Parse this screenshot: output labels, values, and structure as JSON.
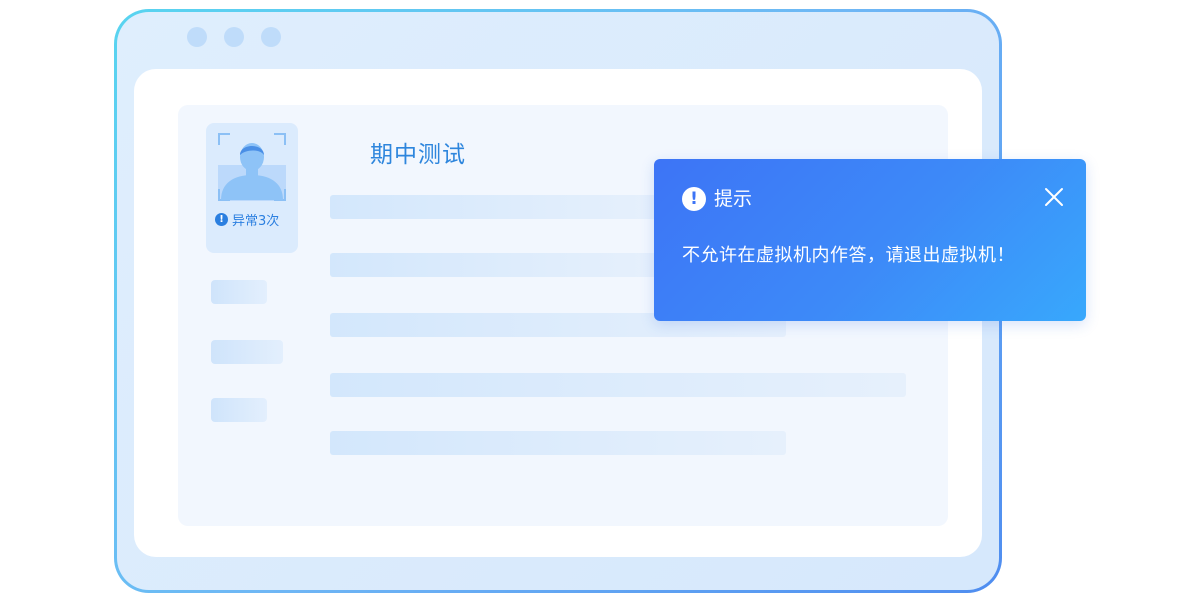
{
  "window": {
    "dots": [
      "dot",
      "dot",
      "dot"
    ]
  },
  "exam": {
    "title": "期中测试",
    "warning_text": "异常3次",
    "warning_icon": "exclamation-icon"
  },
  "dialog": {
    "title": "提示",
    "message": "不允许在虚拟机内作答，请退出虚拟机！",
    "icon": "exclamation-circle-icon",
    "close_icon": "close-icon"
  },
  "colors": {
    "accent": "#2e86dd",
    "dialog_start": "#3d74f6",
    "dialog_end": "#38a8fc"
  }
}
